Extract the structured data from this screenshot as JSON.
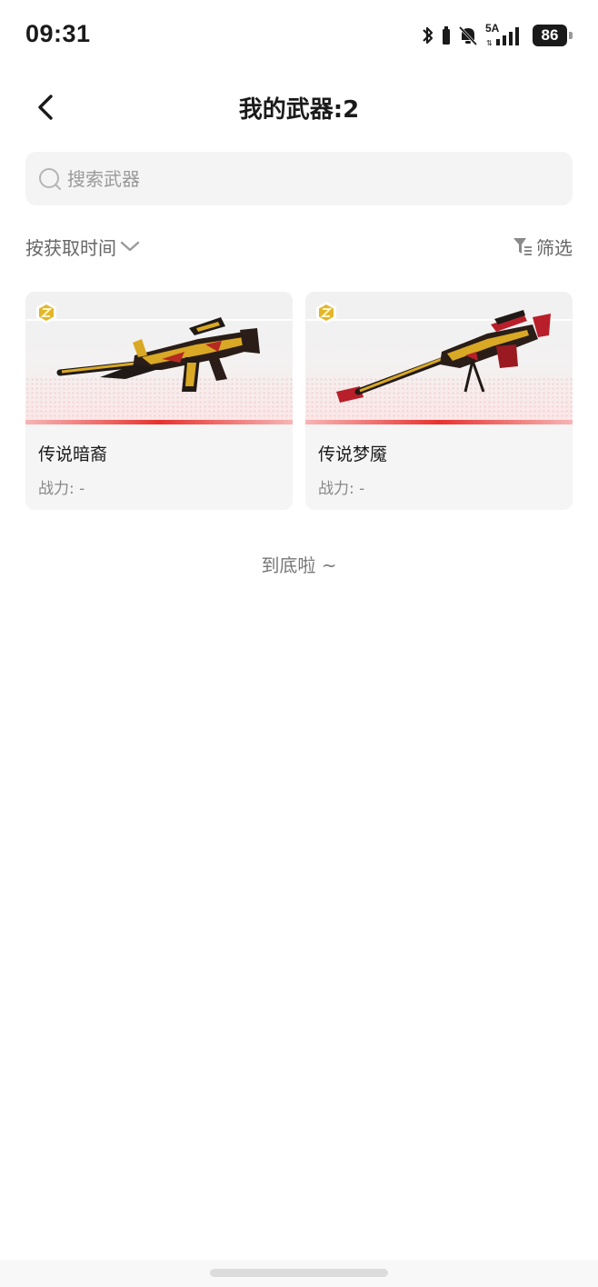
{
  "status_bar": {
    "time": "09:31",
    "network_label": "5A",
    "battery": "86"
  },
  "header": {
    "title": "我的武器:2"
  },
  "search": {
    "placeholder": "搜索武器"
  },
  "toolbar": {
    "sort_label": "按获取时间",
    "filter_label": "筛选"
  },
  "weapons": [
    {
      "name": "传说暗裔",
      "power": "战力: -",
      "rarity_icon": "gold-rarity-icon"
    },
    {
      "name": "传说梦魇",
      "power": "战力: -",
      "rarity_icon": "gold-rarity-icon"
    }
  ],
  "footer": {
    "end_text": "到底啦 ~"
  },
  "colors": {
    "accent_red": "#e9322e",
    "gold": "#e3b62a",
    "card_bg": "#f5f5f5"
  }
}
